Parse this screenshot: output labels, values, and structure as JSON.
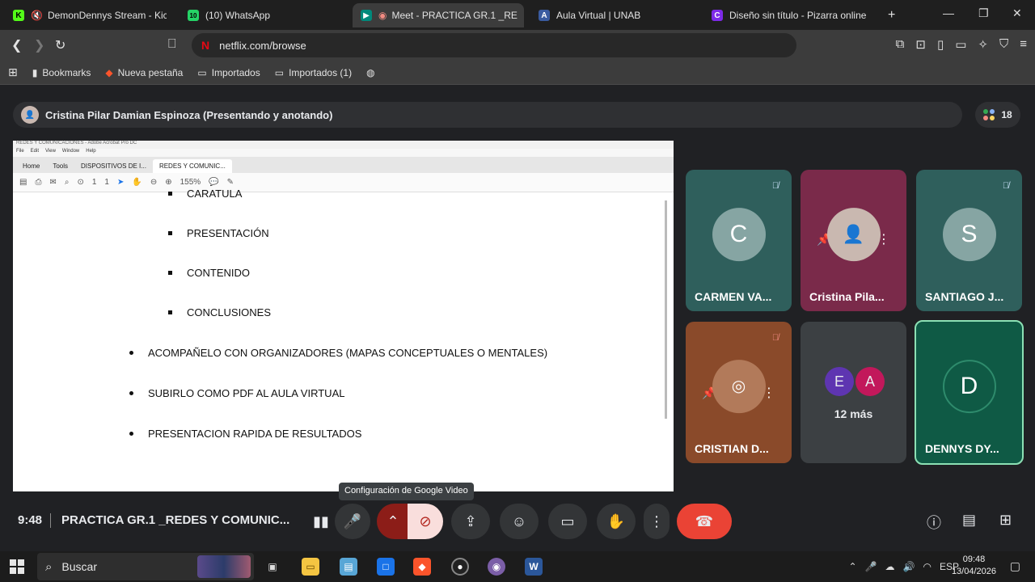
{
  "browser": {
    "tabs": [
      {
        "title": "DemonDennys Stream - Kick D",
        "favicon": "K",
        "favicon_color": "#53fc18",
        "muted": true
      },
      {
        "title": "(10) WhatsApp",
        "favicon": "10",
        "favicon_color": "#25d366"
      },
      {
        "title": "Meet - PRACTICA GR.1 _RE",
        "favicon": "M",
        "favicon_color": "#00897b",
        "active": true
      },
      {
        "title": "Aula Virtual | UNAB",
        "favicon": "A",
        "favicon_color": "#3a5ba0"
      },
      {
        "title": "Diseño sin título - Pizarra online",
        "favicon": "C",
        "favicon_color": "#7d2ae8"
      }
    ],
    "new_tab": "+",
    "url": "netflix.com/browse",
    "bookmarks": [
      {
        "label": "Bookmarks",
        "icon": "bookmark-icon"
      },
      {
        "label": "Nueva pestaña",
        "icon": "brave-icon"
      },
      {
        "label": "Importados",
        "icon": "folder-icon"
      },
      {
        "label": "Importados (1)",
        "icon": "folder-icon"
      }
    ]
  },
  "meet": {
    "presenter": "Cristina Pilar Damian Espinoza (Presentando y anotando)",
    "participant_count": "18",
    "clock": "9:48",
    "meeting_title": "PRACTICA GR.1 _REDES Y COMUNIC...",
    "tooltip": "Configuración de Google Video",
    "tiles": [
      {
        "name": "CARMEN VA...",
        "initial": "C",
        "bg": "#2f5f5c",
        "avatar_bg": "#86a5a3",
        "muted": true
      },
      {
        "name": "Cristina Pila...",
        "initial": "",
        "bg": "#7a2a4a",
        "avatar_bg": "#c9b8b0",
        "muted": false
      },
      {
        "name": "SANTIAGO J...",
        "initial": "S",
        "bg": "#2f5f5c",
        "avatar_bg": "#86a5a3",
        "muted": true
      },
      {
        "name": "CRISTIAN D...",
        "initial": "",
        "bg": "#8a4a2a",
        "avatar_bg": "#b27a5a",
        "muted": true
      },
      {
        "name": "12 más",
        "initials": [
          "E",
          "A"
        ],
        "bg": "#3c4043"
      },
      {
        "name": "DENNYS DY...",
        "initial": "D",
        "bg": "#0f5a45",
        "avatar_bg": "#0f5a45",
        "muted": false
      }
    ]
  },
  "shared_screen": {
    "app_title": "REDES Y COMUNICACIONES - Adobe Acrobat Pro DC",
    "menu": [
      "File",
      "Edit",
      "View",
      "Window",
      "Help"
    ],
    "tabs": [
      "Home",
      "Tools",
      "DISPOSITIVOS DE I...",
      "REDES Y COMUNIC..."
    ],
    "page": "1",
    "pages": "1",
    "zoom": "155%",
    "sub_items": [
      "CARATULA",
      "PRESENTACIÓN",
      "CONTENIDO",
      "CONCLUSIONES"
    ],
    "bullets": [
      "ACOMPAÑELO CON ORGANIZADORES (MAPAS CONCEPTUALES O MENTALES)",
      "SUBIRLO COMO PDF AL AULA VIRTUAL",
      "PRESENTACION RAPIDA DE RESULTADOS"
    ]
  },
  "taskbar": {
    "search": "Buscar",
    "lang": "ESP",
    "time": "09:48",
    "date": "13/04/2026"
  }
}
